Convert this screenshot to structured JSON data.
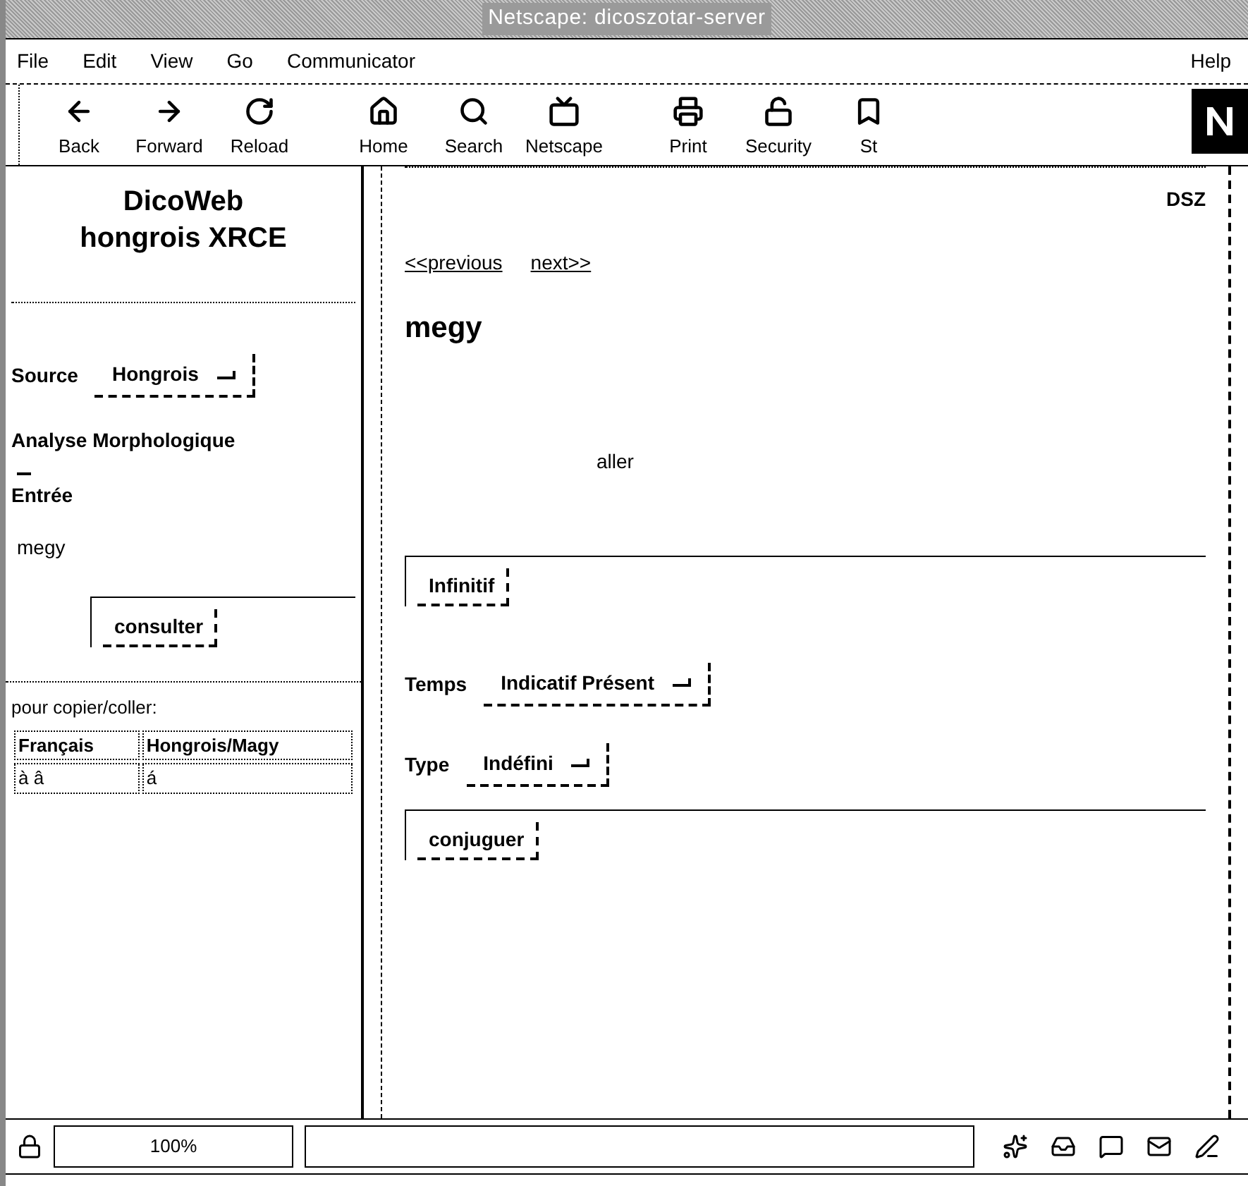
{
  "window": {
    "title": "Netscape: dicoszotar-server"
  },
  "menu": [
    "File",
    "Edit",
    "View",
    "Go",
    "Communicator",
    "Help"
  ],
  "toolbar": [
    {
      "label": "Back"
    },
    {
      "label": "Forward"
    },
    {
      "label": "Reload"
    },
    {
      "label": "Home"
    },
    {
      "label": "Search"
    },
    {
      "label": "Netscape"
    },
    {
      "label": "Print"
    },
    {
      "label": "Security"
    },
    {
      "label": "St"
    }
  ],
  "left_frame": {
    "title": [
      "DicoWeb",
      "hongrois XRCE"
    ],
    "source": {
      "label": "Source",
      "value": "Hongrois"
    },
    "heading": "Analyse Morphologique",
    "entry": {
      "label": "Entrée",
      "value": "megy"
    },
    "button": "consulter",
    "copy_note": "pour copier/coller:",
    "table": {
      "columns": [
        "Français",
        "Hongrois/Magy"
      ],
      "rows": [
        [
          "à â",
          "á"
        ]
      ]
    }
  },
  "right_frame": {
    "corner": "DSZ",
    "links": [
      "<<previous",
      "next>>"
    ],
    "headword": "megy",
    "translation": "aller",
    "infinitive_button": "Infinitif",
    "tense": {
      "label": "Temps",
      "value": "Indicatif Présent"
    },
    "type": {
      "label": "Type",
      "value": "Indéfini"
    },
    "conjugate_button": "conjuguer"
  },
  "status_bar": {
    "zoom": "100%"
  }
}
